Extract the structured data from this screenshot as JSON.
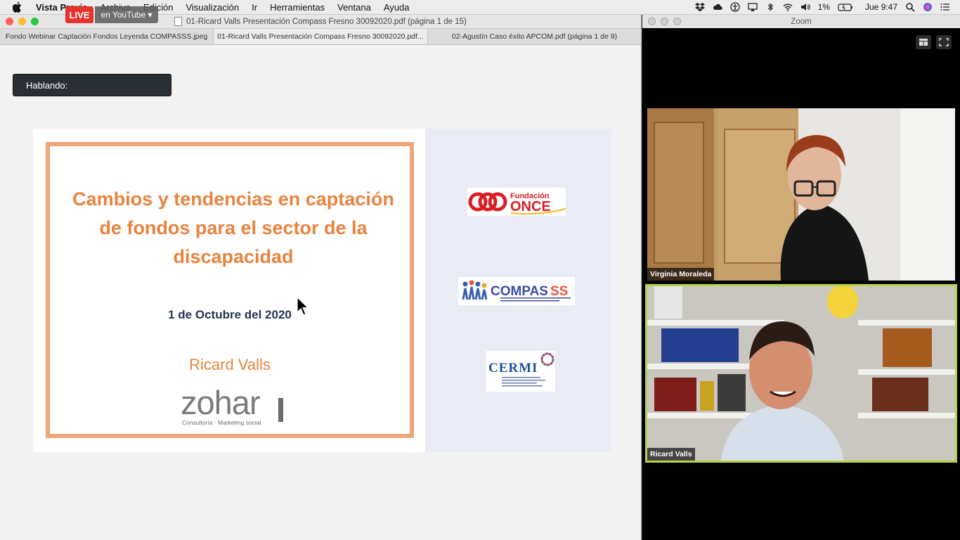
{
  "menubar": {
    "app_name": "Vista Previa",
    "items": [
      "Archivo",
      "Edición",
      "Visualización",
      "Ir",
      "Herramientas",
      "Ventana",
      "Ayuda"
    ],
    "battery": "1%",
    "clock": "Jue 9:47"
  },
  "stream": {
    "live_label": "LIVE",
    "platform_label": "en YouTube ▾"
  },
  "preview": {
    "window_title": "01-Ricard Valls Presentación Compass Fresno 30092020.pdf (página 1 de 15)",
    "tabs": [
      {
        "label": "Fondo Webinar Captación Fondos Leyenda COMPASSS.jpeg"
      },
      {
        "label": "01-Ricard Valls Presentación Compass Fresno 30092020.pdf..."
      },
      {
        "label": "02-Agustín Caso éxito APCOM.pdf (página 1 de 9)"
      }
    ],
    "speaking_label": "Hablando:"
  },
  "slide": {
    "title": "Cambios y tendencias en captación de fondos para el sector de la discapacidad",
    "date": "1 de Octubre del 2020",
    "author": "Ricard Valls",
    "zohar_word": "zohar",
    "zohar_tagline": "Consultoría · Marketing social",
    "once_logo": "Fundación ONCE",
    "compass_logo": "COMPASSS",
    "cermi_logo": "CERMI",
    "colors": {
      "accent": "#e8833f",
      "frame": "#efa679",
      "date": "#26324e"
    }
  },
  "zoom": {
    "window_title": "Zoom",
    "participants": [
      {
        "name": "Virginia Moraleda"
      },
      {
        "name": "Ricard Valls",
        "active_speaker": true
      }
    ],
    "active_speaker_color": "#b6d44a"
  }
}
